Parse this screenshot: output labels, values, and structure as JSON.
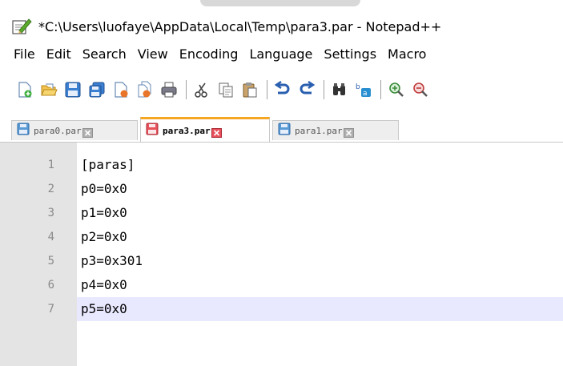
{
  "window": {
    "title": "*C:\\Users\\luofaye\\AppData\\Local\\Temp\\para3.par - Notepad++"
  },
  "menu": [
    "File",
    "Edit",
    "Search",
    "View",
    "Encoding",
    "Language",
    "Settings",
    "Macro"
  ],
  "toolbar": {
    "groups": [
      [
        "new-file-icon",
        "open-file-icon",
        "save-icon",
        "save-all-icon",
        "close-icon",
        "close-all-icon",
        "print-icon"
      ],
      [
        "cut-icon",
        "copy-icon",
        "paste-icon"
      ],
      [
        "undo-icon",
        "redo-icon"
      ],
      [
        "find-icon",
        "replace-icon"
      ],
      [
        "zoom-in-icon",
        "zoom-out-icon"
      ]
    ]
  },
  "tabs": [
    {
      "label": "para0.par",
      "active": false,
      "modified": false
    },
    {
      "label": "para3.par",
      "active": true,
      "modified": true
    },
    {
      "label": "para1.par",
      "active": false,
      "modified": false
    }
  ],
  "editor": {
    "current_line": 7,
    "lines": [
      {
        "num": "1",
        "text": "[paras]"
      },
      {
        "num": "2",
        "text": "p0=0x0"
      },
      {
        "num": "3",
        "text": "p1=0x0"
      },
      {
        "num": "4",
        "text": "p2=0x0"
      },
      {
        "num": "5",
        "text": "p3=0x301"
      },
      {
        "num": "6",
        "text": "p4=0x0"
      },
      {
        "num": "7",
        "text": "p5=0x0"
      }
    ]
  },
  "colors": {
    "saved_tab_icon": "#5b9bd5",
    "modified_tab_icon": "#e8505b",
    "active_tab_accent": "#f5a623",
    "current_line_bg": "#e8e8ff"
  }
}
